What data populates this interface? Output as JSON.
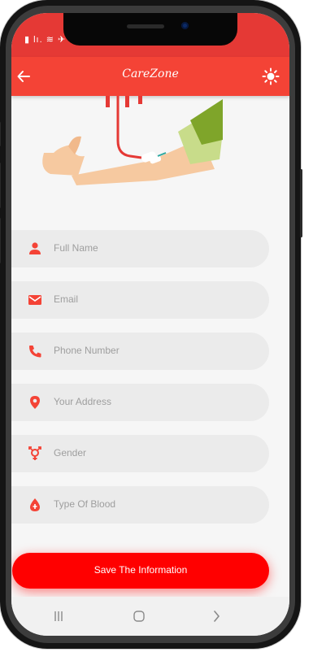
{
  "status_bar": {
    "icons": "▮ lı. ≋ ✈"
  },
  "app_bar": {
    "title": "CareZone",
    "back_icon": "arrow-left-icon",
    "theme_icon": "sun-icon"
  },
  "form": {
    "fields": [
      {
        "placeholder": "Full Name",
        "icon": "person-icon"
      },
      {
        "placeholder": "Email",
        "icon": "envelope-icon"
      },
      {
        "placeholder": "Phone Number",
        "icon": "phone-icon"
      },
      {
        "placeholder": "Your Address",
        "icon": "location-pin-icon"
      },
      {
        "placeholder": "Gender",
        "icon": "gender-icon"
      },
      {
        "placeholder": "Type Of Blood",
        "icon": "blood-drop-icon"
      }
    ]
  },
  "save_button": {
    "label": "Save The Information"
  },
  "nav_bar": {
    "recent": "|||",
    "home": "○",
    "back": ">"
  },
  "colors": {
    "accent": "#f44336",
    "button": "#ff0000",
    "field_bg": "#ebebeb",
    "placeholder": "#9e9e9e"
  }
}
